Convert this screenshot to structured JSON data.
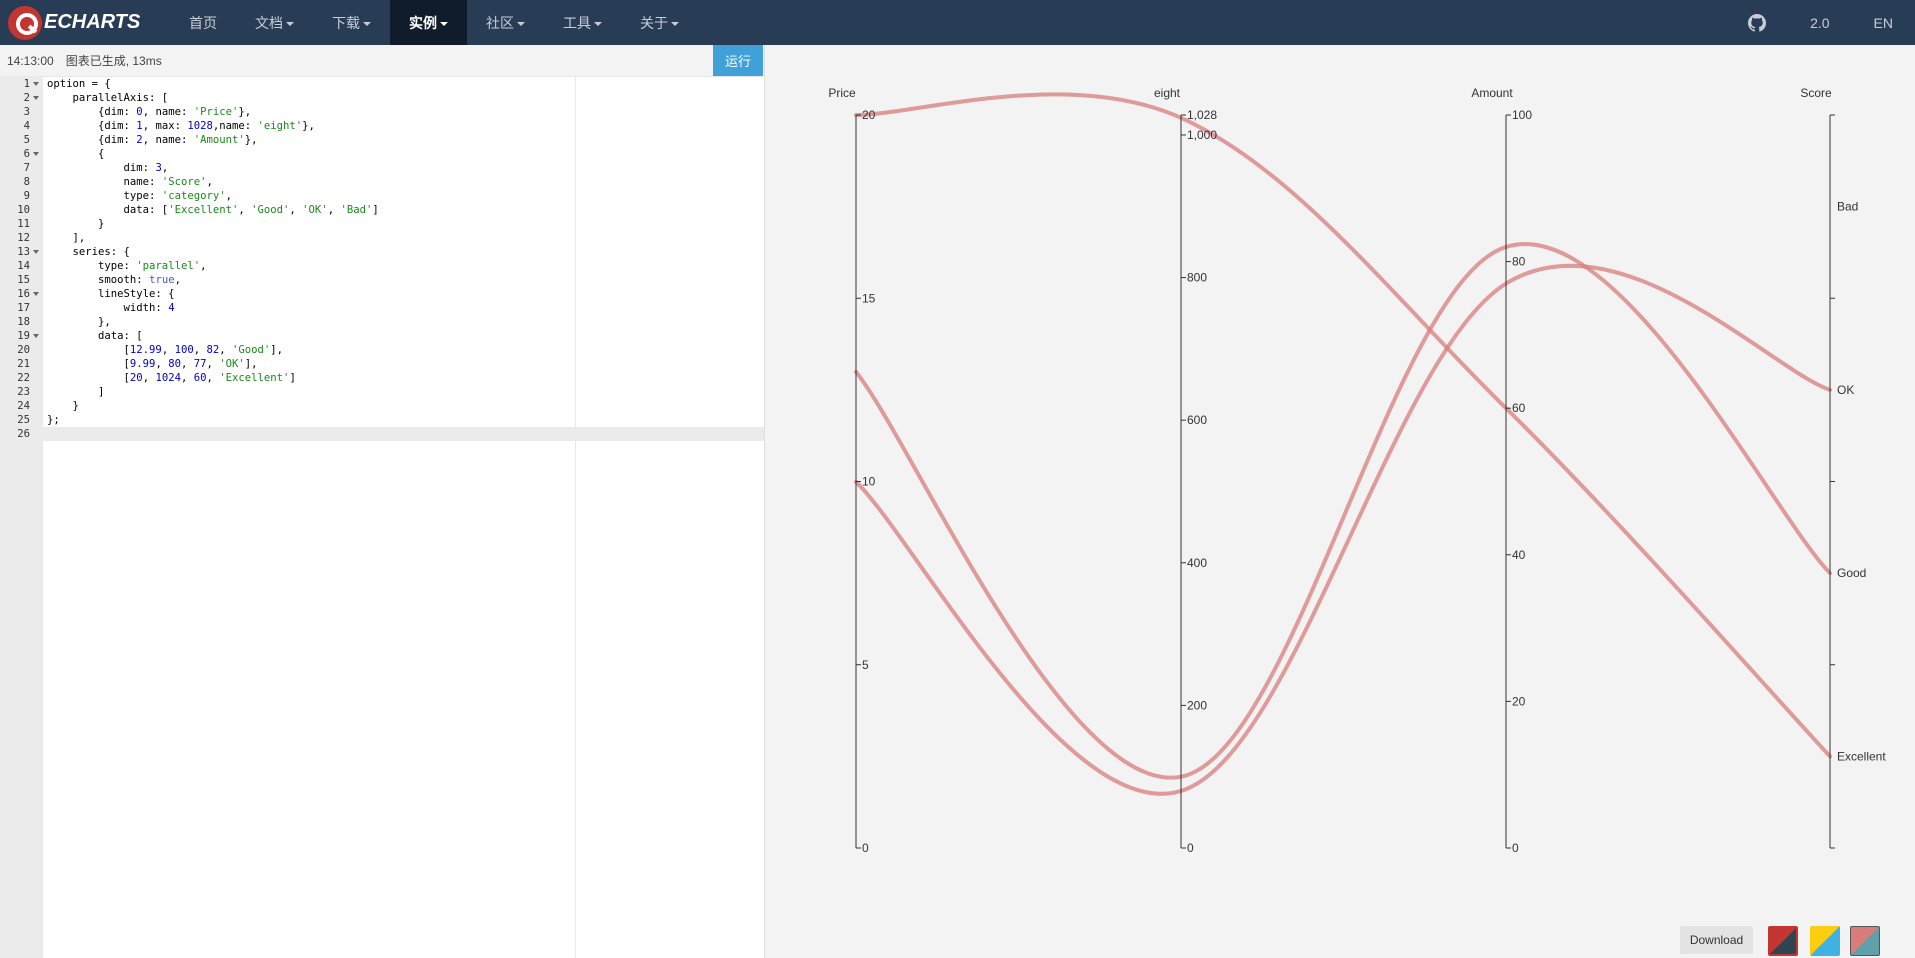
{
  "nav": {
    "brand": "ECHARTS",
    "items": [
      {
        "label": "首页",
        "caret": false,
        "active": false
      },
      {
        "label": "文档",
        "caret": true,
        "active": false
      },
      {
        "label": "下载",
        "caret": true,
        "active": false
      },
      {
        "label": "实例",
        "caret": true,
        "active": true
      },
      {
        "label": "社区",
        "caret": true,
        "active": false
      },
      {
        "label": "工具",
        "caret": true,
        "active": false
      },
      {
        "label": "关于",
        "caret": true,
        "active": false
      }
    ],
    "version": "2.0",
    "lang": "EN"
  },
  "status": {
    "time": "14:13:00",
    "message": "图表已生成, 13ms",
    "run_label": "运行"
  },
  "code_lines": [
    "option = {",
    "    parallelAxis: [",
    "        {dim: 0, name: 'Price'},",
    "        {dim: 1, max: 1028,name: 'eight'},",
    "        {dim: 2, name: 'Amount'},",
    "        {",
    "            dim: 3,",
    "            name: 'Score',",
    "            type: 'category',",
    "            data: ['Excellent', 'Good', 'OK', 'Bad']",
    "        }",
    "    ],",
    "    series: {",
    "        type: 'parallel',",
    "        smooth: true,",
    "        lineStyle: {",
    "            width: 4",
    "        },",
    "        data: [",
    "            [12.99, 100, 82, 'Good'],",
    "            [9.99, 80, 77, 'OK'],",
    "            [20, 1024, 60, 'Excellent']",
    "        ]",
    "    }",
    "};",
    ""
  ],
  "fold_lines": [
    1,
    2,
    6,
    13,
    16,
    19
  ],
  "current_line": 26,
  "chart_data": {
    "type": "parallel",
    "line_color": "#d87c7c",
    "line_width": 4,
    "smooth": true,
    "axes": [
      {
        "name": "Price",
        "type": "value",
        "min": 0,
        "max": 20,
        "ticks": [
          0,
          5,
          10,
          15,
          20
        ],
        "tick_labels": [
          "0",
          "5",
          "10",
          "15",
          "20"
        ]
      },
      {
        "name": "eight",
        "type": "value",
        "min": 0,
        "max": 1028,
        "ticks": [
          0,
          200,
          400,
          600,
          800,
          1000,
          1028
        ],
        "tick_labels": [
          "0",
          "200",
          "400",
          "600",
          "800",
          "1,000",
          "1,028"
        ]
      },
      {
        "name": "Amount",
        "type": "value",
        "min": 0,
        "max": 100,
        "ticks": [
          0,
          20,
          40,
          60,
          80,
          100
        ],
        "tick_labels": [
          "0",
          "20",
          "40",
          "60",
          "80",
          "100"
        ]
      },
      {
        "name": "Score",
        "type": "category",
        "categories": [
          "Excellent",
          "Good",
          "OK",
          "Bad"
        ]
      }
    ],
    "series": [
      {
        "values": [
          12.99,
          100,
          82,
          "Good"
        ]
      },
      {
        "values": [
          9.99,
          80,
          77,
          "OK"
        ]
      },
      {
        "values": [
          20,
          1024,
          60,
          "Excellent"
        ]
      }
    ]
  },
  "download_label": "Download",
  "themes": [
    {
      "name": "theme-red-dark",
      "colors": [
        "#c23531",
        "#2f4554"
      ]
    },
    {
      "name": "theme-yellow-blue",
      "colors": [
        "#fcce10",
        "#3fb1e3"
      ]
    },
    {
      "name": "theme-pink-teal",
      "colors": [
        "#d87c7c",
        "#61a0a8"
      ]
    }
  ]
}
